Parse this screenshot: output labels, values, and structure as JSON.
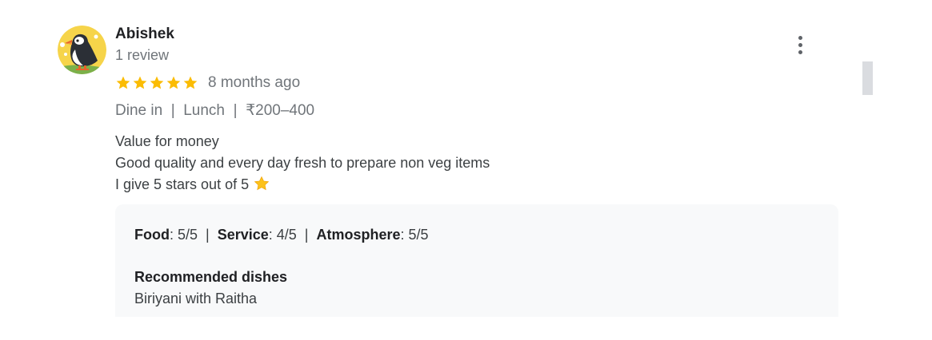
{
  "author": {
    "name": "Abishek",
    "review_count": "1 review",
    "avatar_icon": "puffin-avatar-icon"
  },
  "rating": {
    "stars": 5,
    "max_stars": 5,
    "star_color": "#fbbc04",
    "date": "8 months ago"
  },
  "meta": {
    "service_type": "Dine in",
    "meal_type": "Lunch",
    "price_range": "₹200–400",
    "separator": "|"
  },
  "review_text": {
    "line1": "Value for money",
    "line2": "Good quality and every day fresh to prepare non veg items",
    "line3": "I give 5 stars out of 5",
    "emoji_icon": "star-emoji-icon"
  },
  "sub_ratings": {
    "food_label": "Food",
    "food_value": ": 5/5",
    "service_label": "Service",
    "service_value": ": 4/5",
    "atmosphere_label": "Atmosphere",
    "atmosphere_value": ": 5/5",
    "separator": "  |  "
  },
  "recommended": {
    "heading": "Recommended dishes",
    "dishes": "Biriyani with Raitha"
  },
  "colors": {
    "secondary_text": "#70757a",
    "details_bg": "#f8f9fa",
    "avatar_bg": "#f6d44a"
  }
}
